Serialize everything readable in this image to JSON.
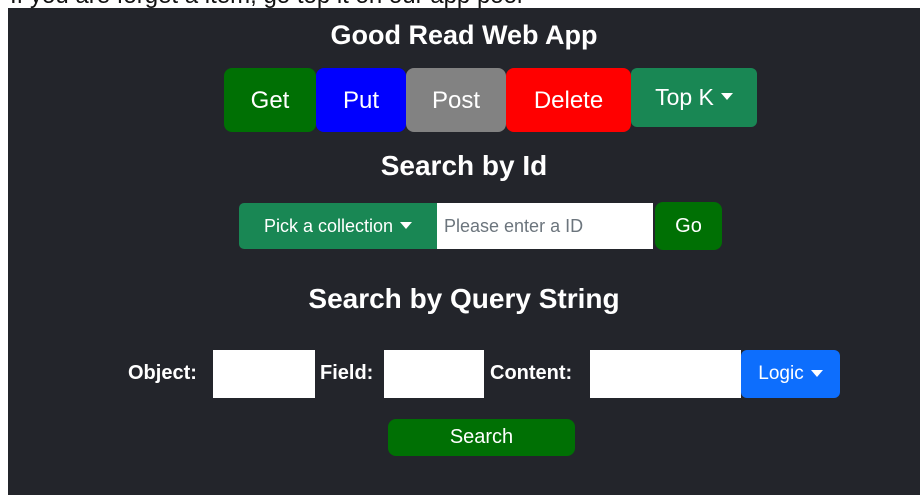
{
  "top_strip": {
    "text": "If you are forget a item, go top it on our app pool"
  },
  "app": {
    "title": "Good Read Web App"
  },
  "actions": {
    "get_label": "Get",
    "put_label": "Put",
    "post_label": "Post",
    "delete_label": "Delete",
    "topk_label": "Top K",
    "colors": {
      "get": "#007004",
      "put": "#0000ff",
      "post": "#828282",
      "delete": "#ff0000",
      "topk": "#198754"
    }
  },
  "search_by_id": {
    "title": "Search by Id",
    "collection_label": "Pick a collection",
    "id_input_value": "",
    "id_input_placeholder": "Please enter a ID",
    "go_label": "Go"
  },
  "query_search": {
    "title": "Search by Query String",
    "object_label": "Object:",
    "object_value": "",
    "field_label": "Field:",
    "field_value": "",
    "content_label": "Content:",
    "content_value": "",
    "logic_label": "Logic",
    "search_label": "Search",
    "logic_color": "#0d6efd"
  },
  "icons": {
    "dropdown_caret": "chevron-down-icon"
  }
}
